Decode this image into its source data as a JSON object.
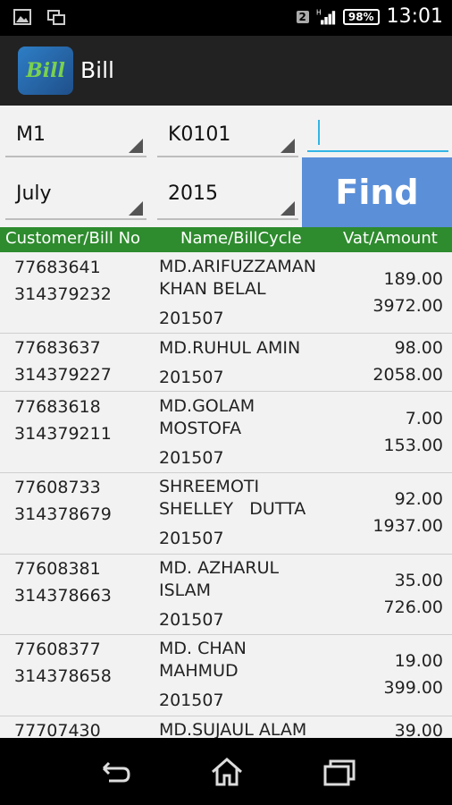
{
  "status_bar": {
    "time": "13:01",
    "battery": "98%",
    "sim": "2",
    "network": "H"
  },
  "app": {
    "title": "Bill",
    "icon_text": "Bill"
  },
  "form": {
    "spinner_1": "M1",
    "spinner_2": "K0101",
    "text_input_value": "",
    "month": "July",
    "year": "2015",
    "find_label": "Find"
  },
  "table": {
    "headers": [
      "Customer/Bill No",
      "Name/BillCycle",
      "Vat/Amount"
    ],
    "rows": [
      {
        "customer": "77683641",
        "bill": "314379232",
        "name_line1": "MD.ARIFUZZAMAN",
        "name_line2": "KHAN BELAL",
        "cycle": "201507",
        "vat": "189.00",
        "amount": "3972.00"
      },
      {
        "customer": "77683637",
        "bill": "314379227",
        "name_line1": "MD.RUHUL AMIN",
        "name_line2": "",
        "cycle": "201507",
        "vat": "98.00",
        "amount": "2058.00"
      },
      {
        "customer": "77683618",
        "bill": "314379211",
        "name_line1": "MD.GOLAM",
        "name_line2": "MOSTOFA",
        "cycle": "201507",
        "vat": "7.00",
        "amount": "153.00"
      },
      {
        "customer": "77608733",
        "bill": "314378679",
        "name_line1": "SHREEMOTI",
        "name_line2": "SHELLEY   DUTTA",
        "cycle": "201507",
        "vat": "92.00",
        "amount": "1937.00"
      },
      {
        "customer": "77608381",
        "bill": "314378663",
        "name_line1": "MD. AZHARUL",
        "name_line2": "ISLAM",
        "cycle": "201507",
        "vat": "35.00",
        "amount": "726.00"
      },
      {
        "customer": "77608377",
        "bill": "314378658",
        "name_line1": "MD. CHAN",
        "name_line2": "MAHMUD",
        "cycle": "201507",
        "vat": "19.00",
        "amount": "399.00"
      },
      {
        "customer": "77707430",
        "bill": "",
        "name_line1": "MD.SUJAUL ALAM",
        "name_line2": "",
        "cycle": "",
        "vat": "39.00",
        "amount": ""
      }
    ]
  },
  "colors": {
    "header_green": "#2e8b2e",
    "find_blue": "#5b8fd8",
    "input_accent": "#33b5e5"
  }
}
